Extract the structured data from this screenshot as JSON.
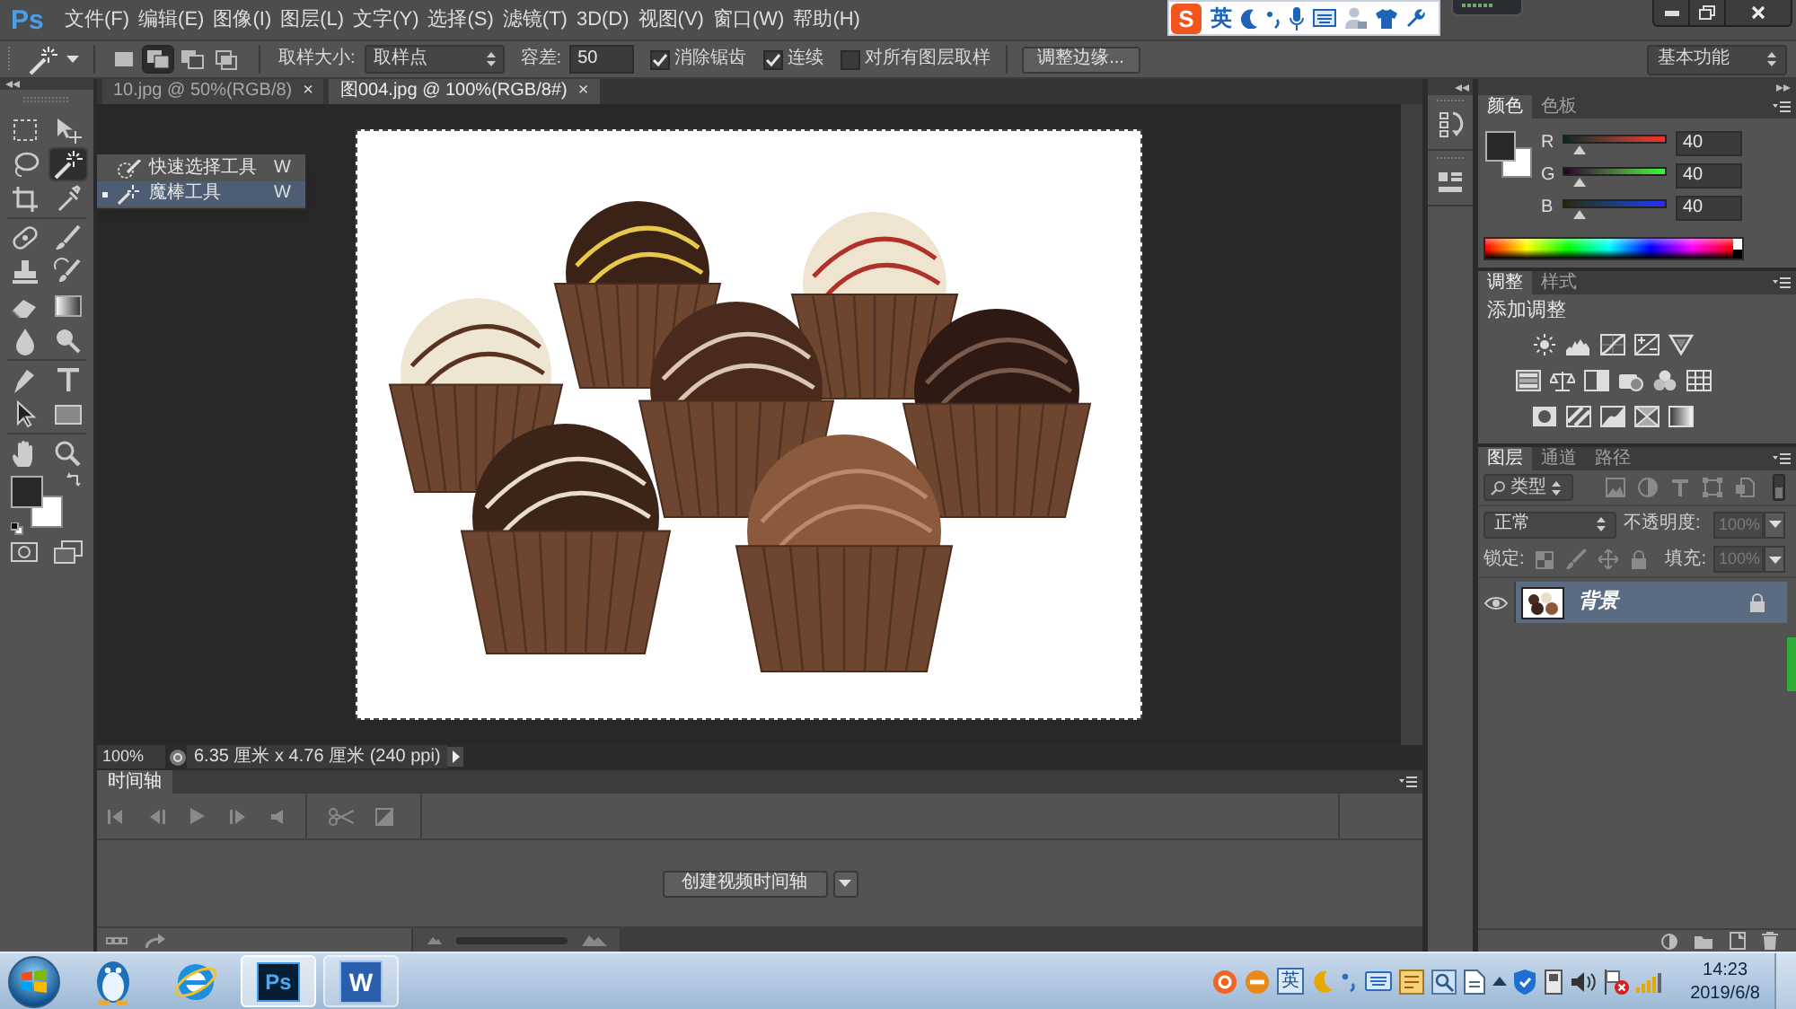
{
  "app": {
    "logo": "Ps"
  },
  "menu": [
    "文件(F)",
    "编辑(E)",
    "图像(I)",
    "图层(L)",
    "文字(Y)",
    "选择(S)",
    "滤镜(T)",
    "3D(D)",
    "视图(V)",
    "窗口(W)",
    "帮助(H)"
  ],
  "ime_bar": {
    "logo": "S",
    "mode": "英"
  },
  "options_bar": {
    "modes": [
      {
        "selected": false
      },
      {
        "selected": true
      },
      {
        "selected": false
      },
      {
        "selected": false
      }
    ],
    "sample_size": {
      "label": "取样大小:",
      "value": "取样点"
    },
    "tolerance": {
      "label": "容差:",
      "value": "50"
    },
    "checkboxes": [
      {
        "label": "消除锯齿",
        "checked": true
      },
      {
        "label": "连续",
        "checked": true
      },
      {
        "label": "对所有图层取样",
        "checked": false
      }
    ],
    "refine_button": "调整边缘...",
    "workspace": "基本功能"
  },
  "tools": [
    {
      "selected": false
    },
    {
      "selected": false
    },
    {
      "selected": false
    },
    {
      "selected": true
    },
    {
      "selected": false
    },
    {
      "selected": false
    },
    {
      "selected": false
    },
    {
      "selected": false
    },
    {
      "selected": false
    },
    {
      "selected": false
    },
    {
      "selected": false
    },
    {
      "selected": false
    },
    {
      "selected": false
    },
    {
      "selected": false
    },
    {
      "selected": false
    },
    {
      "selected": false
    },
    {
      "selected": false
    },
    {
      "selected": false
    },
    {
      "selected": false
    },
    {
      "selected": false
    }
  ],
  "tool_flyout": [
    {
      "label": "快速选择工具",
      "shortcut": "W",
      "selected": false
    },
    {
      "label": "魔棒工具",
      "shortcut": "W",
      "selected": true
    }
  ],
  "document_tabs": [
    {
      "title": "10.jpg @ 50%(RGB/8)",
      "close": "×",
      "selected": false
    },
    {
      "title": "图004.jpg @ 100%(RGB/8#)",
      "close": "×",
      "selected": true
    }
  ],
  "status_bar": {
    "zoom": "100%",
    "document_size": "6.35 厘米 x 4.76 厘米 (240 ppi)"
  },
  "timeline": {
    "tab": "时间轴",
    "create_button": "创建视频时间轴"
  },
  "color_panel": {
    "tabs": [
      {
        "label": "颜色",
        "selected": true
      },
      {
        "label": "色板",
        "selected": false
      }
    ],
    "channels": [
      {
        "name": "R",
        "value": "40",
        "level": 0.157
      },
      {
        "name": "G",
        "value": "40",
        "level": 0.157
      },
      {
        "name": "B",
        "value": "40",
        "level": 0.157
      }
    ]
  },
  "adjustments_panel": {
    "tabs": [
      {
        "label": "调整",
        "selected": true
      },
      {
        "label": "样式",
        "selected": false
      }
    ],
    "heading": "添加调整"
  },
  "layers_panel": {
    "tabs": [
      {
        "label": "图层",
        "selected": true
      },
      {
        "label": "通道",
        "selected": false
      },
      {
        "label": "路径",
        "selected": false
      }
    ],
    "filter": "类型",
    "blend_mode": "正常",
    "opacity": {
      "label": "不透明度:",
      "value": "100%",
      "disabled": true
    },
    "lock_label": "锁定:",
    "fill": {
      "label": "填充:",
      "value": "100%",
      "disabled": true
    },
    "layers": [
      {
        "name": "背景",
        "visible": true,
        "locked": true,
        "selected": true
      }
    ]
  },
  "taskbar": {
    "apps": [
      {
        "kind": "penguin",
        "running": false,
        "selected": false
      },
      {
        "kind": "browser",
        "running": false,
        "selected": false
      },
      {
        "kind": "photoshop",
        "label": "Ps",
        "running": true,
        "selected": true
      },
      {
        "kind": "word",
        "label": "W",
        "running": true,
        "selected": false
      }
    ],
    "tray": {
      "ime_mode": "英"
    },
    "time": "14:23",
    "date": "2019/6/8"
  }
}
